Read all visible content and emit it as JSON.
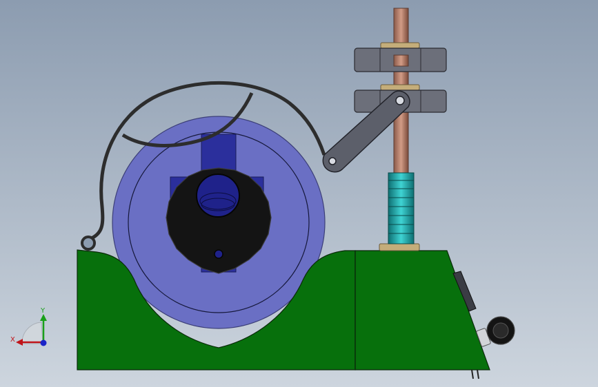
{
  "scene": {
    "background_top": "#8c9cb0",
    "background_bottom": "#cdd5de",
    "base_color": "#07700c",
    "roll_color": "#6a6fc4",
    "hub_color": "#141414",
    "arm_color": "#5c5f6a",
    "bracket_color": "#6c6f7a",
    "rod_color": "#b4826c",
    "spring_color": "#26a8a8",
    "washer_color": "#c4ad7a",
    "cable_color": "#2d2d2d"
  },
  "triad": {
    "x_label": "X",
    "y_label": "Y",
    "x_color": "#c0141a",
    "y_color": "#1aa01a",
    "z_color": "#1a24c8"
  }
}
